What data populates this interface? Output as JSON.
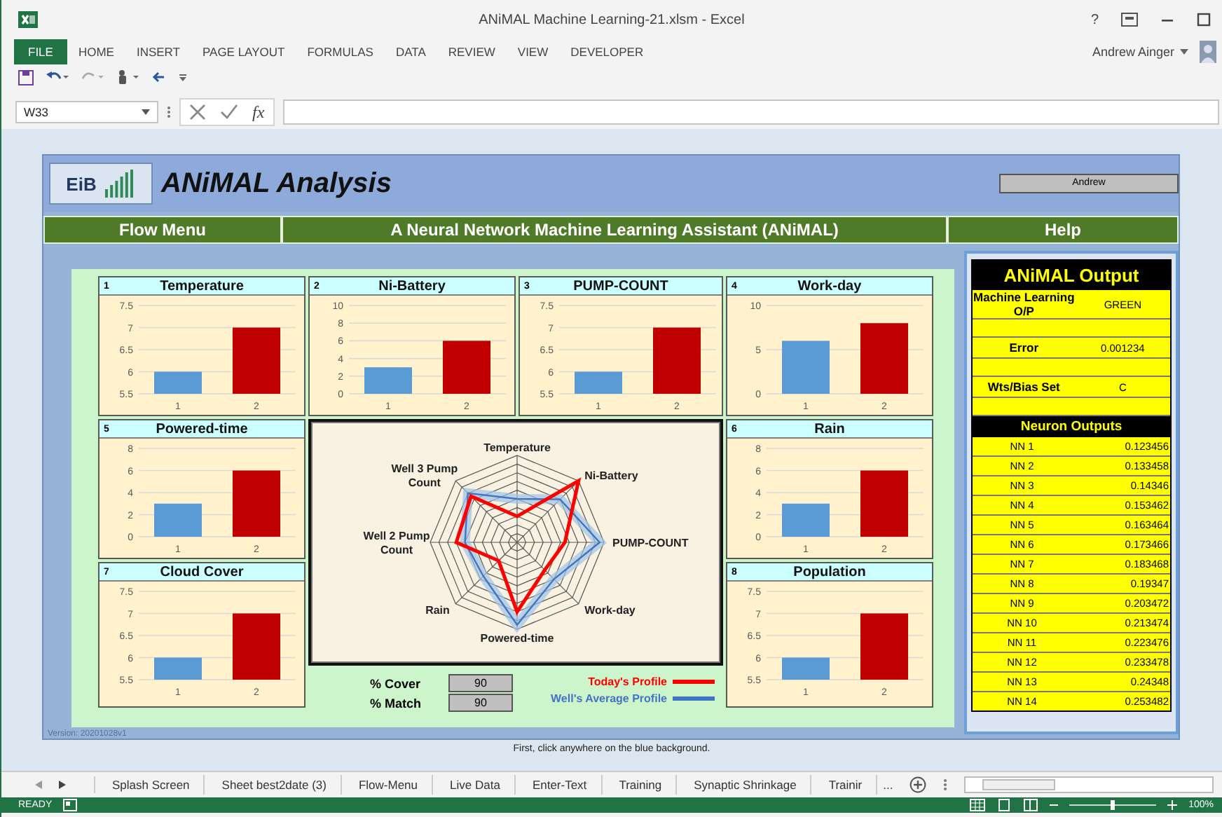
{
  "window": {
    "title": "ANiMAL Machine Learning-21.xlsm - Excel",
    "help": "?"
  },
  "ribbon": {
    "tabs": [
      {
        "label": "FILE",
        "selected": true
      },
      {
        "label": "HOME",
        "selected": false
      },
      {
        "label": "INSERT",
        "selected": false
      },
      {
        "label": "PAGE LAYOUT",
        "selected": false
      },
      {
        "label": "FORMULAS",
        "selected": false
      },
      {
        "label": "DATA",
        "selected": false
      },
      {
        "label": "REVIEW",
        "selected": false
      },
      {
        "label": "VIEW",
        "selected": false
      },
      {
        "label": "DEVELOPER",
        "selected": false
      }
    ],
    "user": "Andrew Ainger"
  },
  "formula_bar": {
    "name_box": "W33",
    "function_label": "fx"
  },
  "dashboard": {
    "logo": "EiB",
    "title": "ANiMAL Analysis",
    "user_box": "Andrew",
    "menu": [
      "Flow Menu",
      "A Neural Network Machine Learning Assistant (ANiMAL)",
      "Help"
    ],
    "version": "Version: 20201028v1"
  },
  "charts": [
    {
      "number": "1",
      "title": "Temperature",
      "chart_data": {
        "type": "bar",
        "grid": true,
        "categories": [
          "1",
          "2"
        ],
        "values": [
          6,
          7
        ],
        "ylim": [
          5.5,
          7.5
        ],
        "yticks": [
          5.5,
          6,
          6.5,
          7,
          7.5
        ]
      }
    },
    {
      "number": "2",
      "title": "Ni-Battery",
      "chart_data": {
        "type": "bar",
        "grid": true,
        "categories": [
          "1",
          "2"
        ],
        "values": [
          3,
          6
        ],
        "ylim": [
          0,
          10
        ],
        "yticks": [
          0,
          2,
          4,
          6,
          8,
          10
        ]
      }
    },
    {
      "number": "3",
      "title": "PUMP-COUNT",
      "chart_data": {
        "type": "bar",
        "grid": true,
        "categories": [
          "1",
          "2"
        ],
        "values": [
          6,
          7
        ],
        "ylim": [
          5.5,
          7.5
        ],
        "yticks": [
          5.5,
          6,
          6.5,
          7,
          7.5
        ]
      }
    },
    {
      "number": "4",
      "title": "Work-day",
      "chart_data": {
        "type": "bar",
        "grid": true,
        "categories": [
          "1",
          "2"
        ],
        "values": [
          6,
          8
        ],
        "ylim": [
          0,
          10
        ],
        "yticks": [
          0,
          5,
          10
        ]
      }
    },
    {
      "number": "5",
      "title": "Powered-time",
      "chart_data": {
        "type": "bar",
        "grid": true,
        "categories": [
          "1",
          "2"
        ],
        "values": [
          3,
          6
        ],
        "ylim": [
          0,
          8
        ],
        "yticks": [
          0,
          2,
          4,
          6,
          8
        ]
      }
    },
    {
      "number": "6",
      "title": "Rain",
      "chart_data": {
        "type": "bar",
        "grid": true,
        "categories": [
          "1",
          "2"
        ],
        "values": [
          3,
          6
        ],
        "ylim": [
          0,
          8
        ],
        "yticks": [
          0,
          2,
          4,
          6,
          8
        ]
      }
    },
    {
      "number": "7",
      "title": "Cloud Cover",
      "chart_data": {
        "type": "bar",
        "grid": true,
        "categories": [
          "1",
          "2"
        ],
        "values": [
          6,
          7
        ],
        "ylim": [
          5.5,
          7.5
        ],
        "yticks": [
          5.5,
          6,
          6.5,
          7,
          7.5
        ]
      }
    },
    {
      "number": "8",
      "title": "Population",
      "chart_data": {
        "type": "bar",
        "grid": true,
        "categories": [
          "1",
          "2"
        ],
        "values": [
          6,
          7
        ],
        "ylim": [
          5.5,
          7.5
        ],
        "yticks": [
          5.5,
          6,
          6.5,
          7,
          7.5
        ]
      }
    }
  ],
  "radar": {
    "axes": [
      "Temperature",
      "Ni-Battery",
      "PUMP-COUNT",
      "Work-day",
      "Powered-time",
      "Rain",
      "Well 2 Pump Count",
      "Well 3 Pump Count"
    ]
  },
  "scores": [
    {
      "label": "% Cover",
      "value": "90"
    },
    {
      "label": "% Match",
      "value": "90"
    }
  ],
  "legend": [
    {
      "label": "Today's Profile",
      "color": "#ff0000"
    },
    {
      "label": "Well's Average Profile",
      "color": "#4472c4"
    }
  ],
  "output": {
    "title": "ANiMAL Output",
    "rows": [
      {
        "kind": "pair",
        "label": "Machine Learning O/P",
        "value": "GREEN"
      },
      {
        "kind": "blank"
      },
      {
        "kind": "pair",
        "label": "Error",
        "value": "0.001234"
      },
      {
        "kind": "blank"
      },
      {
        "kind": "pair",
        "label": "Wts/Bias Set",
        "value": "C"
      },
      {
        "kind": "blank"
      }
    ],
    "neuron_header": "Neuron Outputs",
    "neurons": [
      {
        "name": "NN 1",
        "value": "0.123456"
      },
      {
        "name": "NN 2",
        "value": "0.133458"
      },
      {
        "name": "NN 3",
        "value": "0.14346"
      },
      {
        "name": "NN 4",
        "value": "0.153462"
      },
      {
        "name": "NN 5",
        "value": "0.163464"
      },
      {
        "name": "NN 6",
        "value": "0.173466"
      },
      {
        "name": "NN 7",
        "value": "0.183468"
      },
      {
        "name": "NN 8",
        "value": "0.19347"
      },
      {
        "name": "NN 9",
        "value": "0.203472"
      },
      {
        "name": "NN 10",
        "value": "0.213474"
      },
      {
        "name": "NN 11",
        "value": "0.223476"
      },
      {
        "name": "NN 12",
        "value": "0.233478"
      },
      {
        "name": "NN 13",
        "value": "0.24348"
      },
      {
        "name": "NN 14",
        "value": "0.253482"
      }
    ]
  },
  "hint": "First, click anywhere on the blue background.",
  "sheet_tabs": [
    "Splash Screen",
    "Sheet best2date (3)",
    "Flow-Menu",
    "Live Data",
    "Enter-Text",
    "Training",
    "Synaptic Shrinkage",
    "Trainir"
  ],
  "sheet_tabs_more": "...",
  "status_bar": {
    "mode": "READY",
    "zoom": "100%",
    "zoom_slider": {
      "level": 0.5
    }
  }
}
